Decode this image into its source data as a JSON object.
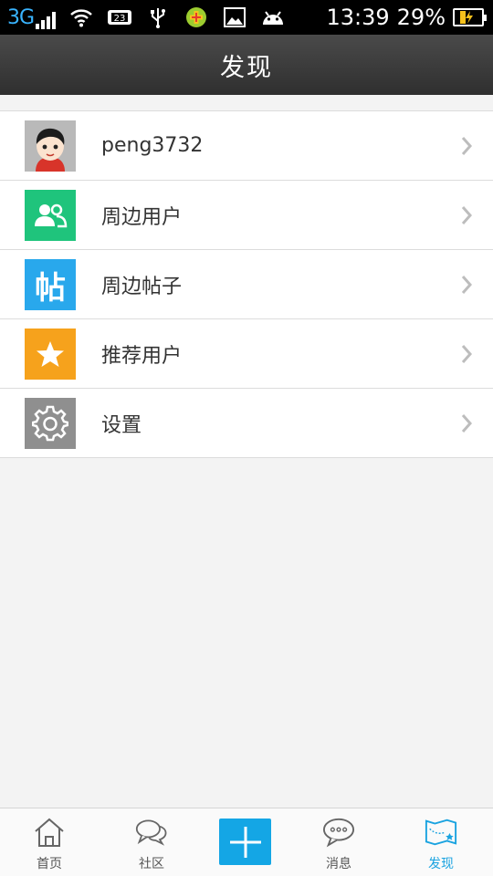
{
  "status_bar": {
    "network": "3G",
    "time": "13:39",
    "battery_percent": "29%",
    "icons": [
      "signal-icon",
      "wifi-icon",
      "sim-card-icon",
      "usb-icon",
      "app-notification-icon",
      "image-icon",
      "android-icon",
      "battery-charging-icon"
    ]
  },
  "header": {
    "title": "发现"
  },
  "menu": {
    "items": [
      {
        "label": "peng3732",
        "icon": "avatar"
      },
      {
        "label": "周边用户",
        "icon": "nearby-users-icon",
        "color": "#1fc47c"
      },
      {
        "label": "周边帖子",
        "icon": "nearby-posts-icon",
        "color": "#29a8ec"
      },
      {
        "label": "推荐用户",
        "icon": "star-icon",
        "color": "#f6a21c"
      },
      {
        "label": "设置",
        "icon": "gear-icon",
        "color": "#8f8f8f"
      }
    ],
    "icon_char_posts": "帖"
  },
  "tabbar": {
    "tabs": [
      {
        "label": "首页",
        "icon": "home-icon"
      },
      {
        "label": "社区",
        "icon": "community-icon"
      },
      {
        "label": "",
        "icon": "plus-icon"
      },
      {
        "label": "消息",
        "icon": "message-icon"
      },
      {
        "label": "发现",
        "icon": "discover-map-icon",
        "active": true
      }
    ],
    "accent": "#1aa3e0"
  }
}
